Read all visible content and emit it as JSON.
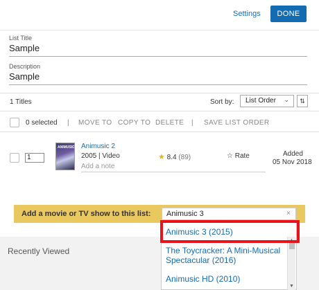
{
  "header": {
    "settings_label": "Settings",
    "done_label": "DONE"
  },
  "list_title": {
    "label": "List Title",
    "value": "Sample"
  },
  "description": {
    "label": "Description",
    "value": "Sample"
  },
  "list_bar": {
    "titles_count": "1 Titles",
    "sort_label": "Sort by:",
    "sort_value": "List Order",
    "sort_direction_icon": "sort-direction-icon"
  },
  "toolbar": {
    "selected": "0 selected",
    "separator": "|",
    "move_to": "MOVE TO",
    "copy_to": "COPY TO",
    "delete": "DELETE",
    "save_order": "SAVE LIST ORDER"
  },
  "items": [
    {
      "position": "1",
      "title": "Animusic 2",
      "meta": "2005 | Video",
      "rating": "8.4",
      "votes": "(89)",
      "rate_label": "Rate",
      "note_placeholder": "Add a note",
      "added_label": "Added",
      "added_date": "05 Nov 2018"
    }
  ],
  "add_bar": {
    "label": "Add a movie or TV show to this list:",
    "input_value": "Animusic 3",
    "clear_icon": "×"
  },
  "recently_viewed": "Recently Viewed",
  "suggestions": [
    "Animusic 3 (2015)",
    "The Toycracker: A Mini-Musical Spectacular (2016)",
    "Animusic HD (2010)"
  ],
  "colors": {
    "accent": "#136cb2",
    "add_bar": "#e9c860",
    "highlight": "#e8141a",
    "star": "#e8b522"
  }
}
